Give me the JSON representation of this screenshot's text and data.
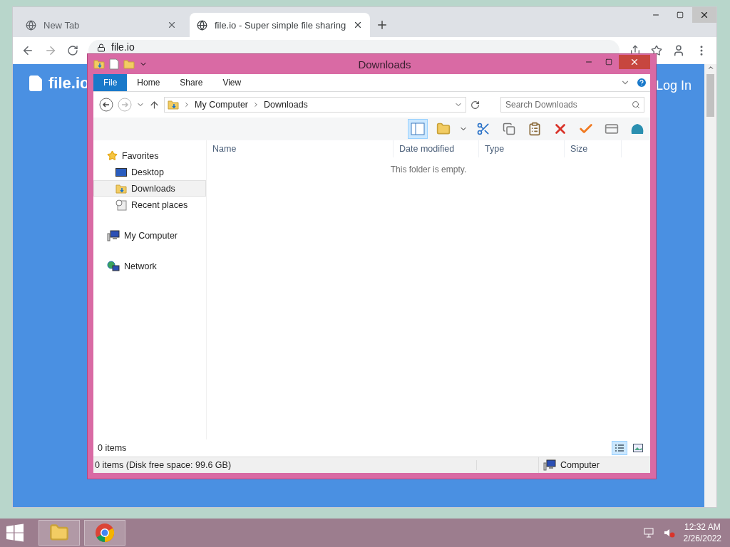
{
  "browser": {
    "tabs": [
      {
        "title": "New Tab",
        "selected": false
      },
      {
        "title": "file.io - Super simple file sharing",
        "selected": true
      }
    ],
    "address": "file.io",
    "page": {
      "logo": "file.io",
      "login": "Log In"
    }
  },
  "explorer": {
    "title": "Downloads",
    "ribbon_tabs": [
      {
        "label": "File",
        "kind": "menu"
      },
      {
        "label": "Home",
        "kind": "tab"
      },
      {
        "label": "Share",
        "kind": "tab"
      },
      {
        "label": "View",
        "kind": "tab"
      }
    ],
    "breadcrumb": [
      "My Computer",
      "Downloads"
    ],
    "search": {
      "placeholder": "Search Downloads"
    },
    "nav": [
      {
        "label": "Favorites",
        "kind": "favorites",
        "selected": false,
        "children": [
          {
            "label": "Desktop",
            "kind": "desktop",
            "selected": false
          },
          {
            "label": "Downloads",
            "kind": "downloads",
            "selected": true
          },
          {
            "label": "Recent places",
            "kind": "recent",
            "selected": false
          }
        ]
      },
      {
        "label": "My Computer",
        "kind": "computer",
        "selected": false
      },
      {
        "label": "Network",
        "kind": "network",
        "selected": false
      }
    ],
    "columns": [
      "Name",
      "Date modified",
      "Type",
      "Size"
    ],
    "empty_message": "This folder is empty.",
    "item_count": "0 items",
    "views": [
      {
        "kind": "details",
        "selected": true
      },
      {
        "kind": "thumbnails",
        "selected": false
      }
    ],
    "status_bar": {
      "left": "0 items (Disk free space: 99.6 GB)",
      "right": "Computer"
    }
  },
  "taskbar": {
    "time": "12:32 AM",
    "date": "2/26/2022"
  }
}
